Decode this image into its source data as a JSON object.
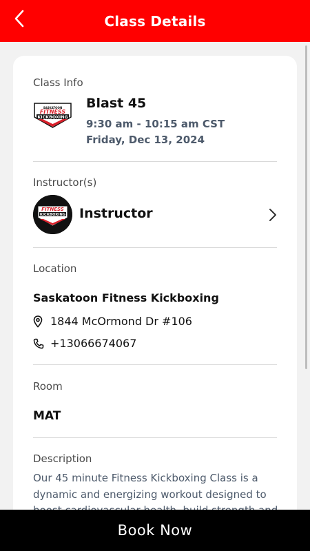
{
  "header": {
    "title": "Class Details",
    "back_icon": "back-arrow-icon",
    "background": "#ff0000"
  },
  "class_info": {
    "label": "Class Info",
    "logo": {
      "top": "SASKATOON",
      "mid": "FITNESS",
      "bottom": "KICKBOXING"
    },
    "name": "Blast 45",
    "time": "9:30 am - 10:15 am CST",
    "date": "Friday, Dec 13, 2024"
  },
  "instructors": {
    "label": "Instructor(s)",
    "name": "Instructor"
  },
  "location": {
    "label": "Location",
    "name": "Saskatoon Fitness Kickboxing",
    "address": "1844 McOrmond Dr #106",
    "phone": "+13066674067"
  },
  "room": {
    "label": "Room",
    "value": "MAT"
  },
  "description": {
    "label": "Description",
    "text": "Our 45 minute Fitness Kickboxing Class is a dynamic and energizing workout designed to boost cardiovascular health, build strength and"
  },
  "footer": {
    "book_label": "Book Now"
  },
  "colors": {
    "accent": "#ff0000",
    "footer": "#000000",
    "secondary_text": "#4d5a6b"
  }
}
